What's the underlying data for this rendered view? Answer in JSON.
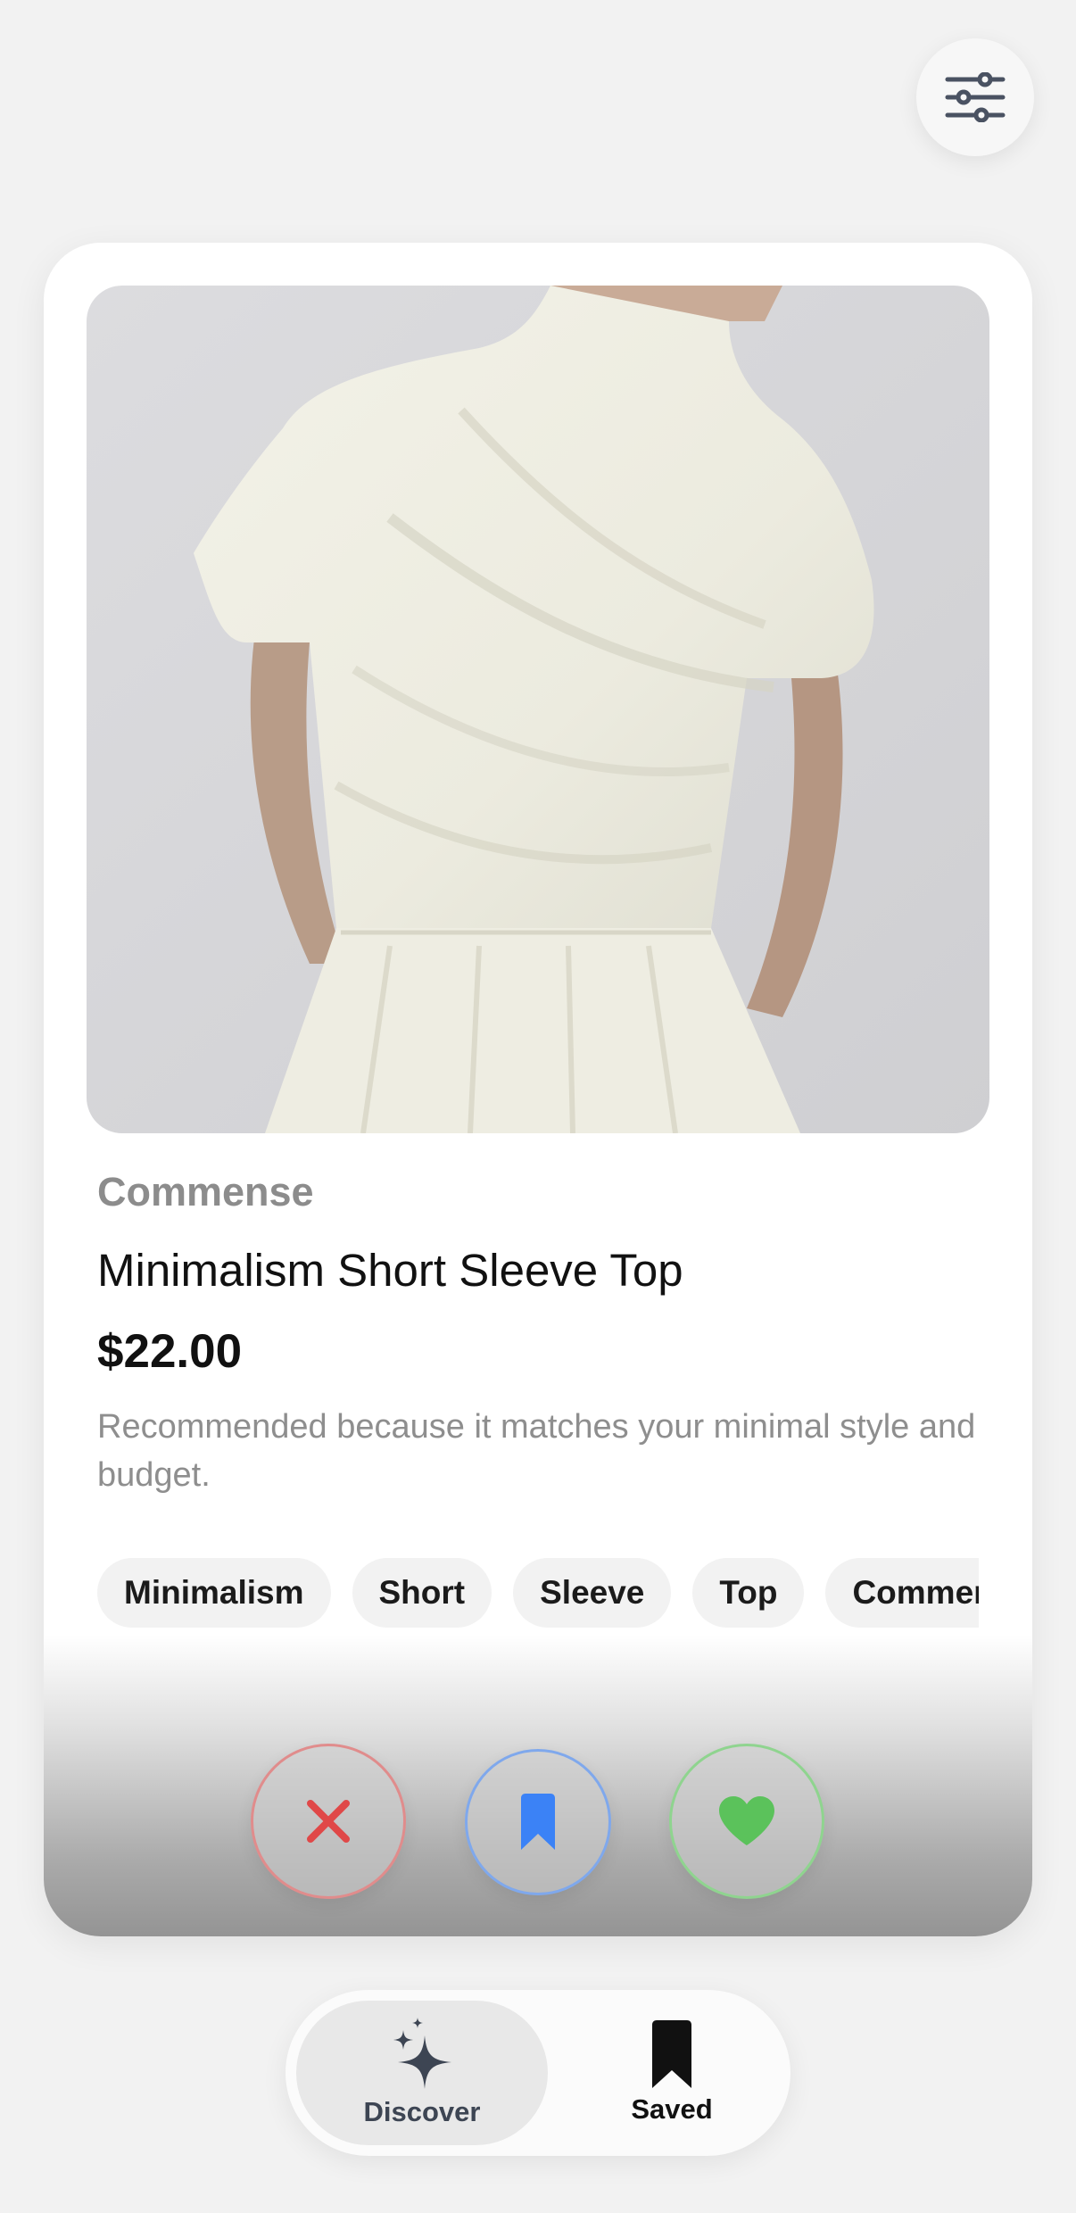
{
  "header": {
    "filter_icon": "sliders-icon"
  },
  "product": {
    "brand": "Commense",
    "title": "Minimalism Short Sleeve Top",
    "price": "$22.00",
    "reason": "Recommended because it matches your minimal style and budget.",
    "tags": [
      "Minimalism",
      "Short",
      "Sleeve",
      "Top",
      "Commense"
    ]
  },
  "actions": {
    "dislike_icon": "x-icon",
    "save_icon": "bookmark-icon",
    "like_icon": "heart-icon",
    "colors": {
      "dislike": "#e04848",
      "save": "#3b82f6",
      "like": "#5bc25b"
    }
  },
  "nav": {
    "discover_label": "Discover",
    "saved_label": "Saved",
    "active": "Discover"
  }
}
